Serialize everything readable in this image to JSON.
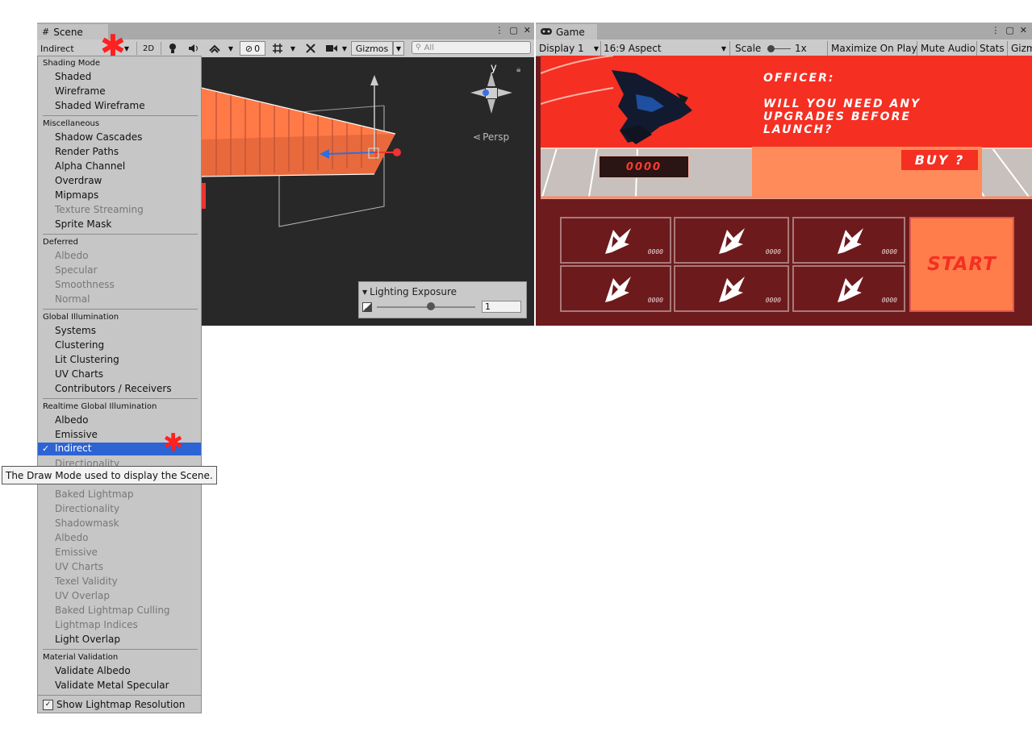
{
  "scene": {
    "tab_label": "Scene",
    "draw_mode_value": "Indirect",
    "toolbar": {
      "btn_2d": "2D",
      "hidden_count": "0",
      "gizmos_label": "Gizmos",
      "search_placeholder": "All"
    },
    "gizmo": {
      "axis_y": "y",
      "persp_label": "Persp"
    },
    "lighting_exposure": {
      "title": "Lighting Exposure",
      "value": "1"
    }
  },
  "draw_mode_menu": {
    "sections": {
      "shading_mode": "Shading Mode",
      "miscellaneous": "Miscellaneous",
      "deferred": "Deferred",
      "global_illumination": "Global Illumination",
      "realtime_gi": "Realtime Global Illumination",
      "material_validation": "Material Validation"
    },
    "items": {
      "shaded": "Shaded",
      "wireframe": "Wireframe",
      "shaded_wireframe": "Shaded Wireframe",
      "shadow_cascades": "Shadow Cascades",
      "render_paths": "Render Paths",
      "alpha_channel": "Alpha Channel",
      "overdraw": "Overdraw",
      "mipmaps": "Mipmaps",
      "texture_streaming": "Texture Streaming",
      "sprite_mask": "Sprite Mask",
      "deferred_albedo": "Albedo",
      "specular": "Specular",
      "smoothness": "Smoothness",
      "normal": "Normal",
      "systems": "Systems",
      "clustering": "Clustering",
      "lit_clustering": "Lit Clustering",
      "gi_uv_charts": "UV Charts",
      "contributors_receivers": "Contributors / Receivers",
      "rt_albedo": "Albedo",
      "rt_emissive": "Emissive",
      "indirect": "Indirect",
      "rt_directionality": "Directionality",
      "baked_lightmap": "Baked Lightmap",
      "baked_directionality": "Directionality",
      "shadowmask": "Shadowmask",
      "baked_albedo": "Albedo",
      "baked_emissive": "Emissive",
      "baked_uv_charts": "UV Charts",
      "texel_validity": "Texel Validity",
      "uv_overlap": "UV Overlap",
      "baked_lightmap_culling": "Baked Lightmap Culling",
      "lightmap_indices": "Lightmap Indices",
      "light_overlap": "Light Overlap",
      "validate_albedo": "Validate Albedo",
      "validate_metal_specular": "Validate Metal Specular",
      "show_lightmap_resolution": "Show Lightmap Resolution"
    },
    "checkmark": "✓",
    "tooltip": "The Draw Mode used to display the Scene."
  },
  "game": {
    "tab_label": "Game",
    "toolbar": {
      "display": "Display 1",
      "aspect": "16:9 Aspect",
      "scale_label": "Scale",
      "scale_value": "1x",
      "maximize_on_play": "Maximize On Play",
      "mute_audio": "Mute Audio",
      "stats": "Stats",
      "gizmos_partial": "Gizm"
    },
    "ui": {
      "officer_line1": "OFFICER:",
      "officer_line2": "WILL YOU NEED ANY",
      "officer_line3": "UPGRADES BEFORE",
      "officer_line4": "LAUNCH?",
      "buy_label": "BUY ?",
      "credits": "0000",
      "start_label": "START",
      "tile_counts": [
        "0000",
        "0000",
        "0000",
        "0000",
        "0000",
        "0000"
      ]
    }
  },
  "colors": {
    "selection": "#2d63d3",
    "annotation_red": "#ff2020",
    "game_red": "#f52f22",
    "game_orange": "#ff7d4a",
    "tile_dark": "#6d1a1c"
  },
  "icons": [
    "scene-hash-icon",
    "kebab-menu-icon",
    "maximize-icon",
    "close-icon",
    "light-bulb-icon",
    "audio-icon",
    "effects-icon",
    "visibility-icon",
    "grid-icon",
    "tools-icon",
    "camera-icon",
    "search-icon",
    "gamepad-icon",
    "lock-icon",
    "rocket-icon"
  ]
}
